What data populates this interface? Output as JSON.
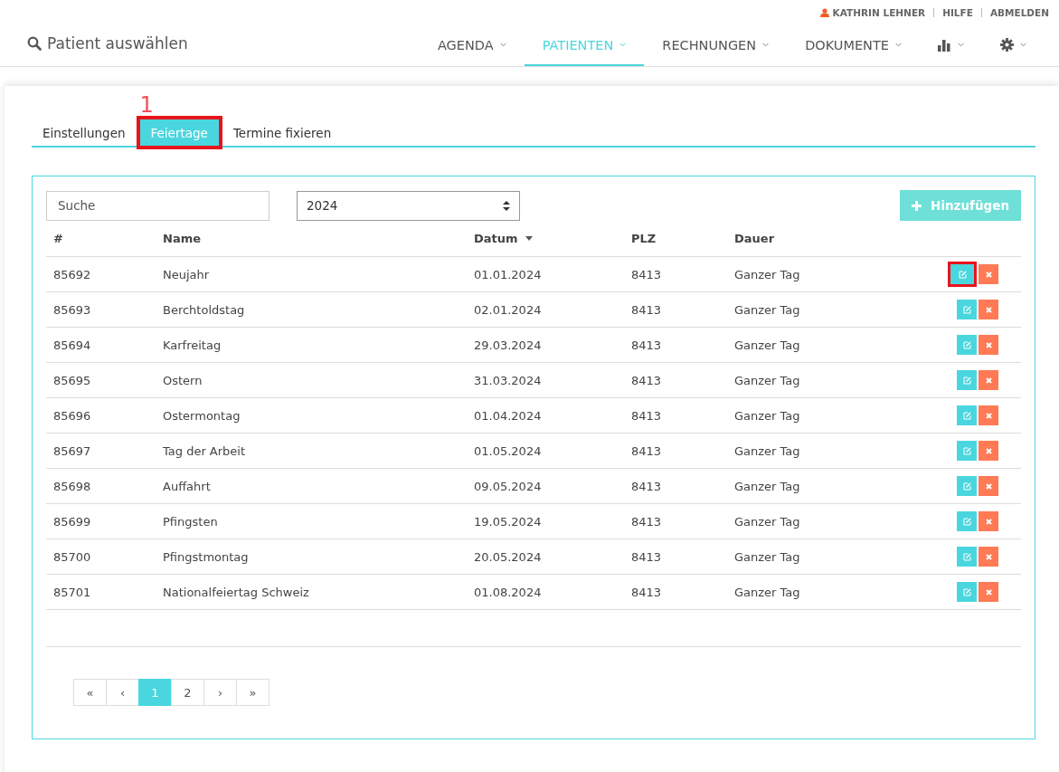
{
  "user_menu": [
    {
      "label": "KATHRIN LEHNER",
      "kind": "user"
    },
    {
      "label": "HILFE",
      "kind": "link"
    },
    {
      "label": "ABMELDEN",
      "kind": "link"
    }
  ],
  "patient_search": {
    "label": "Patient auswählen"
  },
  "nav": [
    {
      "label": "AGENDA",
      "kind": "text",
      "selected": false
    },
    {
      "label": "PATIENTEN",
      "kind": "text",
      "selected": true
    },
    {
      "label": "RECHNUNGEN",
      "kind": "text",
      "selected": false
    },
    {
      "label": "DOKUMENTE",
      "kind": "text",
      "selected": false
    },
    {
      "kind": "chart",
      "selected": false
    },
    {
      "kind": "gear",
      "selected": false
    }
  ],
  "annotation": {
    "label": "1"
  },
  "tabs": [
    {
      "label": "Einstellungen",
      "selected": false,
      "highlighted": false
    },
    {
      "label": "Feiertage",
      "selected": true,
      "highlighted": true
    },
    {
      "label": "Termine fixieren",
      "selected": false,
      "highlighted": false
    }
  ],
  "search": {
    "placeholder": "Suche"
  },
  "year_select": {
    "value": "2024"
  },
  "add_button": {
    "label": "Hinzufügen"
  },
  "table": {
    "columns": [
      {
        "label": "#",
        "sorted": false
      },
      {
        "label": "Name",
        "sorted": false
      },
      {
        "label": "Datum",
        "sorted": true
      },
      {
        "label": "PLZ",
        "sorted": false
      },
      {
        "label": "Dauer",
        "sorted": false
      }
    ],
    "rows": [
      {
        "id": "85692",
        "name": "Neujahr",
        "date": "01.01.2024",
        "plz": "8413",
        "duration": "Ganzer Tag",
        "highlighted": true
      },
      {
        "id": "85693",
        "name": "Berchtoldstag",
        "date": "02.01.2024",
        "plz": "8413",
        "duration": "Ganzer Tag",
        "highlighted": false
      },
      {
        "id": "85694",
        "name": "Karfreitag",
        "date": "29.03.2024",
        "plz": "8413",
        "duration": "Ganzer Tag",
        "highlighted": false
      },
      {
        "id": "85695",
        "name": "Ostern",
        "date": "31.03.2024",
        "plz": "8413",
        "duration": "Ganzer Tag",
        "highlighted": false
      },
      {
        "id": "85696",
        "name": "Ostermontag",
        "date": "01.04.2024",
        "plz": "8413",
        "duration": "Ganzer Tag",
        "highlighted": false
      },
      {
        "id": "85697",
        "name": "Tag der Arbeit",
        "date": "01.05.2024",
        "plz": "8413",
        "duration": "Ganzer Tag",
        "highlighted": false
      },
      {
        "id": "85698",
        "name": "Auffahrt",
        "date": "09.05.2024",
        "plz": "8413",
        "duration": "Ganzer Tag",
        "highlighted": false
      },
      {
        "id": "85699",
        "name": "Pfingsten",
        "date": "19.05.2024",
        "plz": "8413",
        "duration": "Ganzer Tag",
        "highlighted": false
      },
      {
        "id": "85700",
        "name": "Pfingstmontag",
        "date": "20.05.2024",
        "plz": "8413",
        "duration": "Ganzer Tag",
        "highlighted": false
      },
      {
        "id": "85701",
        "name": "Nationalfeiertag Schweiz",
        "date": "01.08.2024",
        "plz": "8413",
        "duration": "Ganzer Tag",
        "highlighted": false
      }
    ]
  },
  "pagination": [
    {
      "label": "«",
      "selected": false
    },
    {
      "label": "‹",
      "selected": false
    },
    {
      "label": "1",
      "selected": true
    },
    {
      "label": "2",
      "selected": false
    },
    {
      "label": "›",
      "selected": false
    },
    {
      "label": "»",
      "selected": false
    }
  ]
}
